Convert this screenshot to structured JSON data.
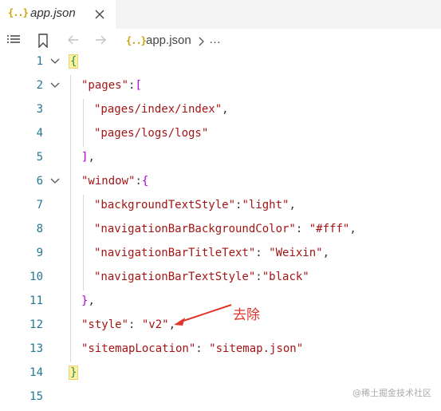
{
  "tab": {
    "icon": "{..}",
    "filename": "app.json",
    "close_icon": "close-icon"
  },
  "breadcrumb": {
    "icon": "{..}",
    "filename": "app.json",
    "more": "…"
  },
  "lines": [
    {
      "n": "1"
    },
    {
      "n": "2"
    },
    {
      "n": "3"
    },
    {
      "n": "4"
    },
    {
      "n": "5"
    },
    {
      "n": "6"
    },
    {
      "n": "7"
    },
    {
      "n": "8"
    },
    {
      "n": "9"
    },
    {
      "n": "10"
    },
    {
      "n": "11"
    },
    {
      "n": "12"
    },
    {
      "n": "13"
    },
    {
      "n": "14"
    },
    {
      "n": "15"
    }
  ],
  "code": {
    "l1_open": "{",
    "l2_key": "\"pages\"",
    "l2_colon": ":",
    "l2_bracket": "[",
    "l3_val": "\"pages/index/index\"",
    "l3_comma": ",",
    "l4_val": "\"pages/logs/logs\"",
    "l5_close": "]",
    "l5_comma": ",",
    "l6_key": "\"window\"",
    "l6_colon": ":",
    "l6_brace": "{",
    "l7_key": "\"backgroundTextStyle\"",
    "l7_colon": ":",
    "l7_val": "\"light\"",
    "l7_comma": ",",
    "l8_key": "\"navigationBarBackgroundColor\"",
    "l8_colon": ": ",
    "l8_val": "\"#fff\"",
    "l8_comma": ",",
    "l9_key": "\"navigationBarTitleText\"",
    "l9_colon": ": ",
    "l9_val": "\"Weixin\"",
    "l9_comma": ",",
    "l10_key": "\"navigationBarTextStyle\"",
    "l10_colon": ":",
    "l10_val": "\"black\"",
    "l11_close": "}",
    "l11_comma": ",",
    "l12_key": "\"style\"",
    "l12_colon": ": ",
    "l12_val": "\"v2\"",
    "l12_comma": ",",
    "l13_key": "\"sitemapLocation\"",
    "l13_colon": ": ",
    "l13_val": "\"sitemap.json\"",
    "l14_close": "}"
  },
  "annotation": "去除",
  "watermark": "@稀土掘金技术社区",
  "colors": {
    "string": "#a31515",
    "line_number": "#237893",
    "annotation": "#e0342c",
    "json_icon": "#c9a300"
  }
}
